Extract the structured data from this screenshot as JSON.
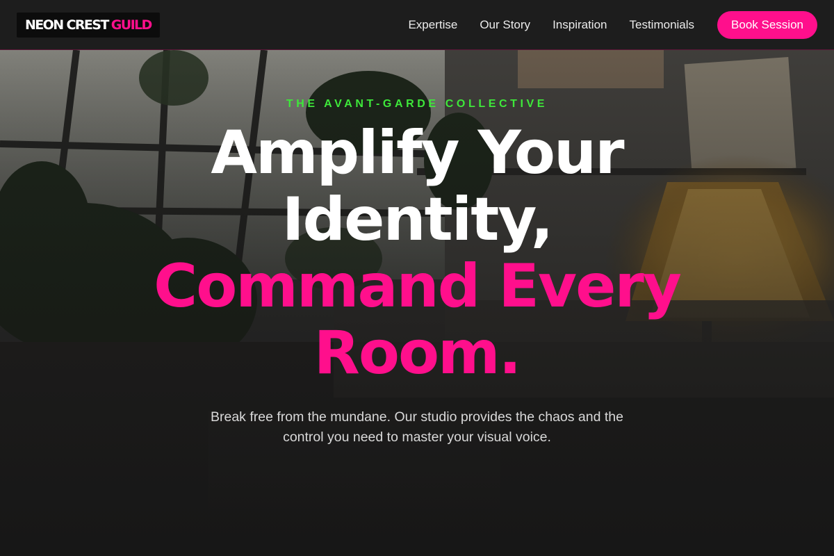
{
  "header": {
    "logo": {
      "part1": "NEON CREST",
      "part2": "GUILD"
    },
    "nav": [
      {
        "label": "Expertise"
      },
      {
        "label": "Our Story"
      },
      {
        "label": "Inspiration"
      },
      {
        "label": "Testimonials"
      }
    ],
    "cta_label": "Book Session"
  },
  "hero": {
    "eyebrow": "THE AVANT-GARDE COLLECTIVE",
    "headline": {
      "line1": "Amplify Your",
      "line2": "Identity,",
      "line3": "Command Every",
      "line4": "Room."
    },
    "subtext_line1": "Break free from the mundane. Our studio provides the chaos and the",
    "subtext_line2": "control you need to master your visual voice."
  },
  "colors": {
    "accent_pink": "#ff0f8c",
    "accent_green": "#3ee83a",
    "header_bg": "#1d1d1d",
    "page_bg": "#161616"
  }
}
